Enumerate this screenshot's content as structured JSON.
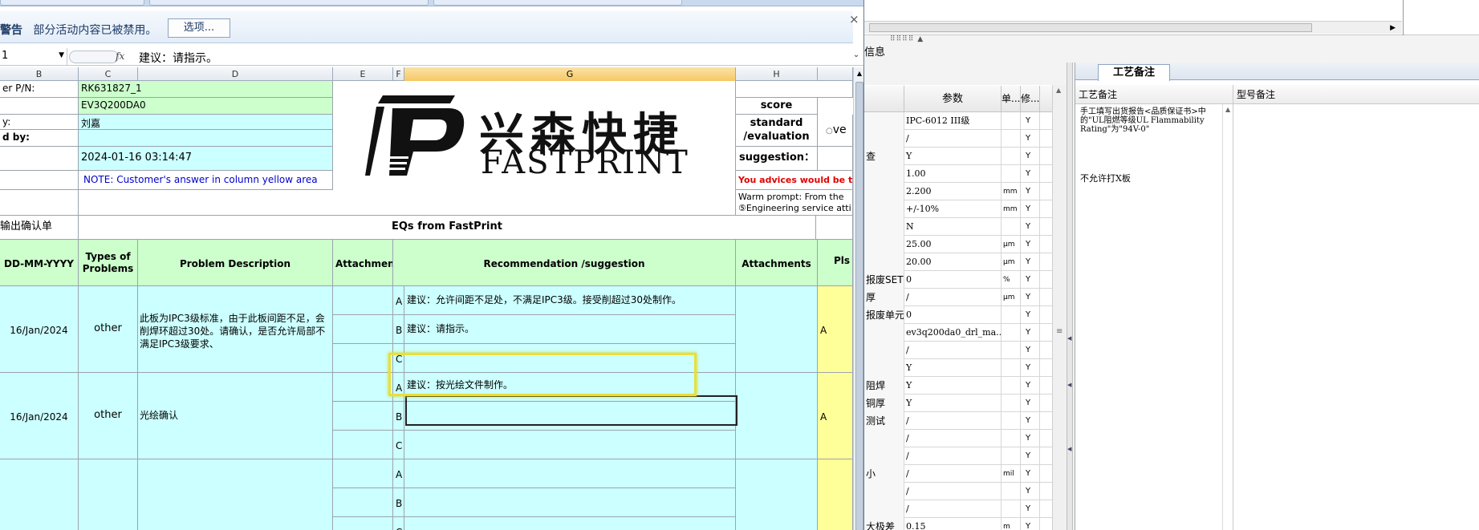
{
  "message_bar": {
    "warning_label": "警告",
    "text": "部分活动内容已被禁用。",
    "options_button": "选项...",
    "close": "×"
  },
  "formula_bar": {
    "name_box": "1",
    "fx": "fx",
    "content": "建议：请指示。"
  },
  "columns": [
    "B",
    "C",
    "D",
    "E",
    "F",
    "G",
    "H"
  ],
  "header_block": {
    "labels": [
      "er P/N:",
      "",
      "y:",
      "d by:",
      "",
      ""
    ],
    "values": [
      "RK631827_1",
      "EV3Q200DA0",
      "刘嘉",
      "",
      "2024-01-16 03:14:47",
      "NOTE: Customer's  answer in column yellow area"
    ]
  },
  "logo": {
    "chinese": "兴森快捷",
    "english": "FASTPRINT"
  },
  "score_block": {
    "score": "score",
    "standard": "standard /evaluation",
    "radio": "ve",
    "suggestion": "suggestion：",
    "advices": "You advices would be the",
    "warm_prompt": "Warm prompt:  From the",
    "engineering": "⑤Engineering service atti"
  },
  "section": {
    "left_title": "输出确认单",
    "eq_title": "EQs from FastPrint"
  },
  "table_headers": {
    "date": "DD-MM-YYYY",
    "types": "Types of Problems",
    "description": "Problem Description",
    "attachment": "Attachment",
    "recommendation": "Recommendation /suggestion",
    "attachments": "Attachments",
    "pls": "Pls"
  },
  "eq_rows": [
    {
      "date": "16/Jan/2024",
      "type": "other",
      "description": "此板为IPC3级标准，由于此板间距不足，会削焊环超过30处。请确认，是否允许局部不满足IPC3级要求、",
      "options": [
        {
          "letter": "A",
          "text": "建议：允许间距不足处，不满足IPC3级。接受削超过30处制作。"
        },
        {
          "letter": "B",
          "text": "建议：请指示。"
        },
        {
          "letter": "C",
          "text": ""
        }
      ],
      "answer": "A"
    },
    {
      "date": "16/Jan/2024",
      "type": "other",
      "description": "光绘确认",
      "options": [
        {
          "letter": "A",
          "text": "建议：按光绘文件制作。"
        },
        {
          "letter": "B",
          "text": ""
        },
        {
          "letter": "C",
          "text": ""
        }
      ],
      "answer": "A"
    },
    {
      "date": "",
      "type": "",
      "description": "",
      "options": [
        {
          "letter": "A",
          "text": ""
        },
        {
          "letter": "B",
          "text": ""
        },
        {
          "letter": "C",
          "text": ""
        }
      ],
      "answer": ""
    }
  ],
  "right_app": {
    "info_title": "信息",
    "param_headers": {
      "param": "参数",
      "unit": "单...",
      "mod": "修..."
    },
    "params": [
      {
        "name": "",
        "value": "IPC-6012 III级",
        "unit": "",
        "mod": "Y"
      },
      {
        "name": "",
        "value": "/",
        "unit": "",
        "mod": "Y"
      },
      {
        "name": "查",
        "value": "Y",
        "unit": "",
        "mod": "Y"
      },
      {
        "name": "",
        "value": "1.00",
        "unit": "",
        "mod": "Y"
      },
      {
        "name": "",
        "value": "2.200",
        "unit": "mm",
        "mod": "Y"
      },
      {
        "name": "",
        "value": "+/-10%",
        "unit": "mm",
        "mod": "Y"
      },
      {
        "name": "",
        "value": "N",
        "unit": "",
        "mod": "Y"
      },
      {
        "name": "",
        "value": "25.00",
        "unit": "μm",
        "mod": "Y"
      },
      {
        "name": "",
        "value": "20.00",
        "unit": "μm",
        "mod": "Y"
      },
      {
        "name": "报废SET",
        "value": "0",
        "unit": "%",
        "mod": "Y"
      },
      {
        "name": "厚",
        "value": "/",
        "unit": "μm",
        "mod": "Y"
      },
      {
        "name": "报废单元",
        "value": "0",
        "unit": "",
        "mod": "Y"
      },
      {
        "name": "",
        "value": "ev3q200da0_drl_ma...",
        "unit": "",
        "mod": "Y"
      },
      {
        "name": "",
        "value": "/",
        "unit": "",
        "mod": "Y"
      },
      {
        "name": "",
        "value": "Y",
        "unit": "",
        "mod": "Y"
      },
      {
        "name": "阻焊",
        "value": "Y",
        "unit": "",
        "mod": "Y"
      },
      {
        "name": "铜厚",
        "value": "Y",
        "unit": "",
        "mod": "Y"
      },
      {
        "name": "测试",
        "value": "/",
        "unit": "",
        "mod": "Y"
      },
      {
        "name": "",
        "value": "/",
        "unit": "",
        "mod": "Y"
      },
      {
        "name": "",
        "value": "/",
        "unit": "",
        "mod": "Y"
      },
      {
        "name": "小",
        "value": "/",
        "unit": "mil",
        "mod": "Y"
      },
      {
        "name": "",
        "value": "/",
        "unit": "",
        "mod": "Y"
      },
      {
        "name": "",
        "value": "/",
        "unit": "",
        "mod": "Y"
      },
      {
        "name": "大极差",
        "value": "0.15",
        "unit": "m",
        "mod": "Y"
      }
    ],
    "craft_tab": "工艺备注",
    "craft_headers": {
      "col1": "工艺备注",
      "col2": "型号备注"
    },
    "craft_note1": "手工填写出货报告<品质保证书>中的\"UL阻燃等级UL Flammability Rating\"为\"94V-0\"",
    "craft_note2": "不允许打X板"
  }
}
